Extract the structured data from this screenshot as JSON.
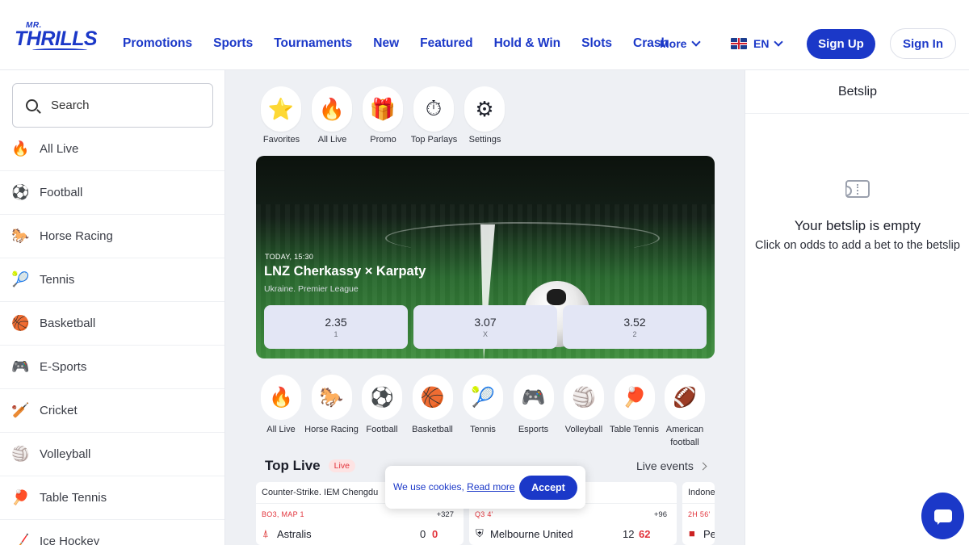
{
  "header": {
    "logo_top": "MR.",
    "logo_main": "THRILLS",
    "nav": [
      "Promotions",
      "Sports",
      "Tournaments",
      "New",
      "Featured",
      "Hold & Win",
      "Slots",
      "Crash"
    ],
    "more": "More",
    "lang": "EN",
    "signup": "Sign Up",
    "signin": "Sign In"
  },
  "sidebar": {
    "search_placeholder": "Search",
    "items": [
      {
        "label": "All Live",
        "icon": "🔥"
      },
      {
        "label": "Football",
        "icon": "⚽"
      },
      {
        "label": "Horse Racing",
        "icon": "🐎"
      },
      {
        "label": "Tennis",
        "icon": "🎾"
      },
      {
        "label": "Basketball",
        "icon": "🏀"
      },
      {
        "label": "E-Sports",
        "icon": "🎮"
      },
      {
        "label": "Cricket",
        "icon": "🏏"
      },
      {
        "label": "Volleyball",
        "icon": "🏐"
      },
      {
        "label": "Table Tennis",
        "icon": "🏓"
      },
      {
        "label": "Ice Hockey",
        "icon": "🏒"
      }
    ]
  },
  "quick": [
    {
      "label": "Favorites",
      "icon": "⭐"
    },
    {
      "label": "All Live",
      "icon": "🔥"
    },
    {
      "label": "Promo",
      "icon": "🎁"
    },
    {
      "label": "Top Parlays",
      "icon": "⏱"
    },
    {
      "label": "Settings",
      "icon": "⚙"
    }
  ],
  "hero": {
    "when": "TODAY, 15:30",
    "match": "LNZ Cherkassy × Karpaty",
    "league": "Ukraine. Premier League",
    "odds": [
      {
        "value": "2.35",
        "key": "1"
      },
      {
        "value": "3.07",
        "key": "X"
      },
      {
        "value": "3.52",
        "key": "2"
      }
    ]
  },
  "sports": [
    {
      "label": "All Live",
      "icon": "🔥"
    },
    {
      "label": "Horse Racing",
      "icon": "🐎"
    },
    {
      "label": "Football",
      "icon": "⚽"
    },
    {
      "label": "Basketball",
      "icon": "🏀"
    },
    {
      "label": "Tennis",
      "icon": "🎾"
    },
    {
      "label": "Esports",
      "icon": "🎮"
    },
    {
      "label": "Volleyball",
      "icon": "🏐"
    },
    {
      "label": "Table Tennis",
      "icon": "🏓"
    },
    {
      "label": "American football",
      "icon": "🏈"
    }
  ],
  "toplive": {
    "title": "Top Live",
    "badge": "Live",
    "events_link": "Live events"
  },
  "cards": [
    {
      "league": "Counter-Strike. IEM Chengdu",
      "status": "BO3, MAP 1",
      "markets": "+327",
      "team": "Astralis",
      "s1": "0",
      "s2": "0"
    },
    {
      "league": "",
      "status": "Q3 4'",
      "markets": "+96",
      "team": "Melbourne United",
      "s1": "12",
      "s2": "62"
    },
    {
      "league": "Indones",
      "status": "2H 56'",
      "markets": "",
      "team": "Pe",
      "s1": "",
      "s2": ""
    }
  ],
  "cookie": {
    "text": "We use cookies,",
    "link": "Read more",
    "accept": "Accept"
  },
  "betslip": {
    "title": "Betslip",
    "empty_title": "Your betslip is empty",
    "empty_sub": "Click on odds to add a bet to the betslip"
  }
}
